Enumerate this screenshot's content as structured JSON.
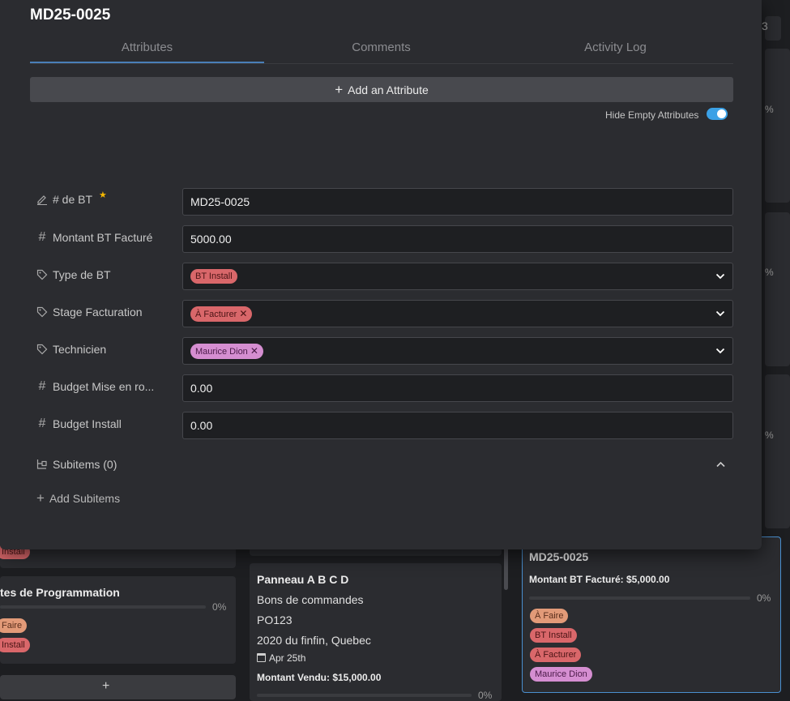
{
  "modal": {
    "title": "MD25-0025",
    "tabs": [
      "Attributes",
      "Comments",
      "Activity Log"
    ],
    "add_attribute": "Add an Attribute",
    "hide_empty_label": "Hide Empty Attributes",
    "hide_empty_on": true,
    "fields": [
      {
        "label": "# de BT",
        "icon": "edit-pencil-icon",
        "value": "MD25-0025",
        "required": true
      },
      {
        "label": "Montant BT Facturé",
        "icon": "hash-icon",
        "value": "5000.00"
      },
      {
        "label": "Type de BT",
        "icon": "tag-icon",
        "tag": "BT Install"
      },
      {
        "label": "Stage Facturation",
        "icon": "tag-icon",
        "tag": "À Facturer"
      },
      {
        "label": "Technicien",
        "icon": "tag-icon",
        "tag": "Maurice Dion"
      },
      {
        "label": "Budget Mise en ro...",
        "icon": "hash-icon",
        "value": "0.00"
      },
      {
        "label": "Budget Install",
        "icon": "hash-icon",
        "value": "0.00"
      }
    ],
    "subitems_label": "Subitems (0)",
    "add_subitems": "Add Subitems"
  },
  "background": {
    "right_pcts": [
      "%",
      "%",
      "%"
    ],
    "left_card": {
      "tag": "Install",
      "title": "tes de Programmation",
      "pct": "0%",
      "tags": [
        "Faire",
        "Install"
      ],
      "add_symbol": "+"
    },
    "middle_card": {
      "title": "Panneau A B C D",
      "lines": [
        "Bons de commandes",
        "PO123",
        "2020 du finfin, Quebec"
      ],
      "date": "Apr 25th",
      "montant": "Montant Vendu: $15,000.00",
      "pct": "0%"
    },
    "right_card": {
      "title": "MD25-0025",
      "montant": "Montant BT Facturé: $5,000.00",
      "pct": "0%",
      "tags": [
        "À Faire",
        "BT Install",
        "À Facturer",
        "Maurice Dion"
      ]
    },
    "top_right_char": "3"
  },
  "colors": {
    "accent": "#4a7fb8",
    "toggle": "#3ba1e6",
    "tag_red": "#d9676a",
    "tag_orange": "#e29a78",
    "tag_pink": "#d58ed1"
  }
}
